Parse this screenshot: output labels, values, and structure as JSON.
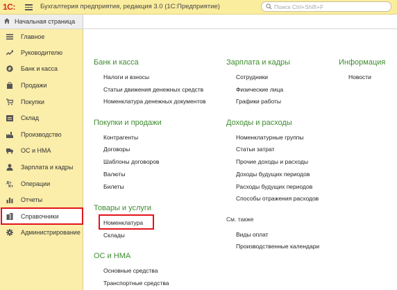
{
  "app": {
    "logo": "1С:",
    "title": "Бухгалтерия предприятия, редакция 3.0  (1С:Предприятие)",
    "search_placeholder": "Поиск Ctrl+Shift+F"
  },
  "home_tab": {
    "label": "Начальная страница"
  },
  "sidebar": {
    "items": [
      {
        "label": "Главное",
        "icon": "list-icon"
      },
      {
        "label": "Руководителю",
        "icon": "trend-icon"
      },
      {
        "label": "Банк и касса",
        "icon": "coin-icon"
      },
      {
        "label": "Продажи",
        "icon": "bag-icon"
      },
      {
        "label": "Покупки",
        "icon": "cart-icon"
      },
      {
        "label": "Склад",
        "icon": "warehouse-icon"
      },
      {
        "label": "Производство",
        "icon": "factory-icon"
      },
      {
        "label": "ОС и НМА",
        "icon": "truck-icon"
      },
      {
        "label": "Зарплата и кадры",
        "icon": "person-icon"
      },
      {
        "label": "Операции",
        "icon": "operations-icon"
      },
      {
        "label": "Отчеты",
        "icon": "chart-icon"
      },
      {
        "label": "Справочники",
        "icon": "books-icon"
      },
      {
        "label": "Администрирование",
        "icon": "gear-icon"
      }
    ],
    "active": "Справочники"
  },
  "main": {
    "col1": {
      "bank": {
        "title": "Банк и касса",
        "links": [
          "Налоги и взносы",
          "Статьи движения денежных средств",
          "Номенклатура денежных документов"
        ]
      },
      "sales": {
        "title": "Покупки и продажи",
        "links": [
          "Контрагенты",
          "Договоры",
          "Шаблоны договоров",
          "Валюты",
          "Билеты"
        ]
      },
      "goods": {
        "title": "Товары и услуги",
        "links": [
          "Номенклатура",
          "Склады"
        ]
      },
      "assets": {
        "title": "ОС и НМА",
        "links": [
          "Основные средства",
          "Транспортные средства"
        ]
      }
    },
    "col2": {
      "salary": {
        "title": "Зарплата и кадры",
        "links": [
          "Сотрудники",
          "Физические лица",
          "Графики работы"
        ]
      },
      "income": {
        "title": "Доходы и расходы",
        "links": [
          "Номенклатурные группы",
          "Статьи затрат",
          "Прочие доходы и расходы",
          "Доходы будущих периодов",
          "Расходы будущих периодов",
          "Способы отражения расходов"
        ]
      },
      "see_also": {
        "title": "См. также",
        "links": [
          "Виды оплат",
          "Производственные календари"
        ]
      }
    },
    "col3": {
      "info": {
        "title": "Информация",
        "links": [
          "Новости"
        ]
      }
    }
  },
  "colors": {
    "sidebar_bg": "#fbedaa",
    "titlebar_bg": "#fbed9e",
    "section_title": "#3d8c2f",
    "highlight": "#e2131a"
  }
}
